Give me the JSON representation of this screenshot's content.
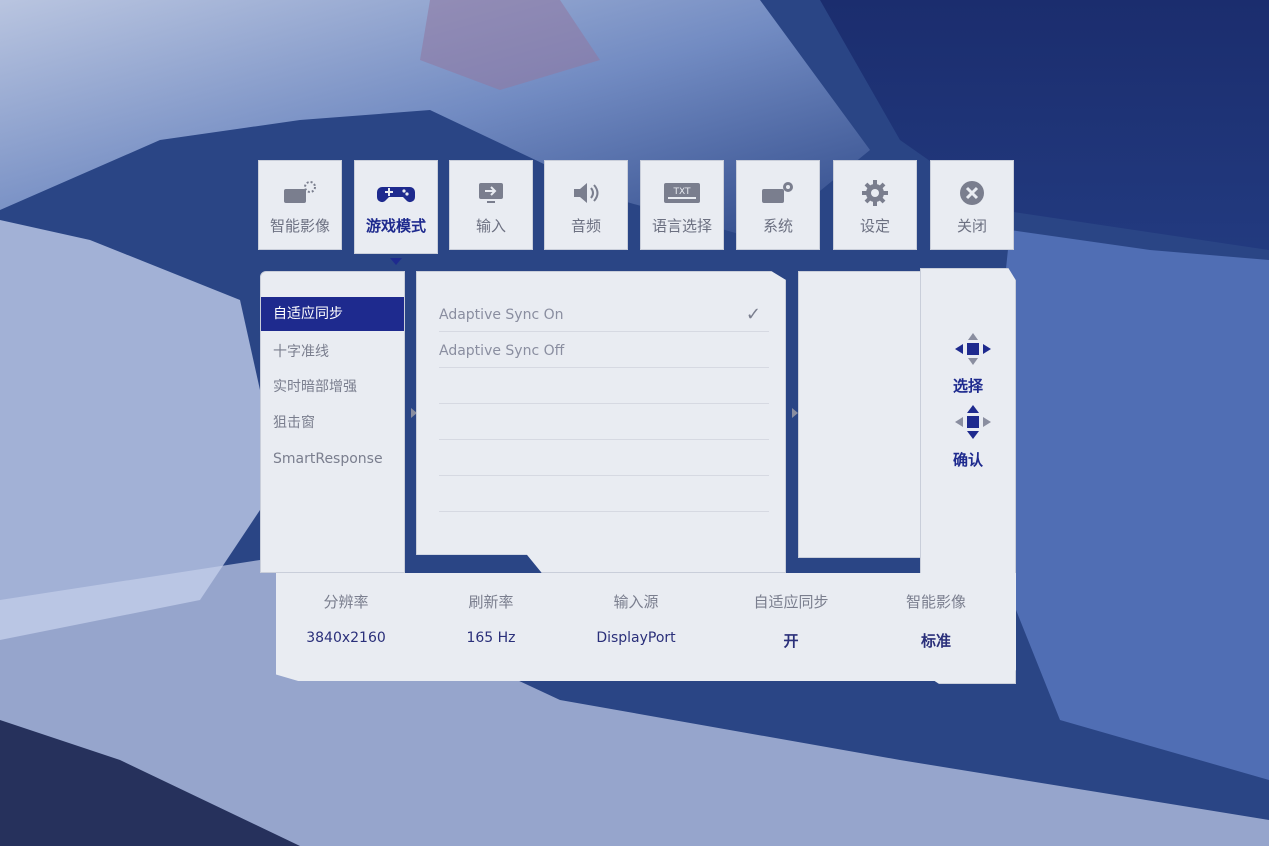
{
  "tabs": [
    {
      "label": "智能影像",
      "icon": "smart-image-icon",
      "active": false
    },
    {
      "label": "游戏模式",
      "icon": "gamepad-icon",
      "active": true
    },
    {
      "label": "输入",
      "icon": "input-icon",
      "active": false
    },
    {
      "label": "音频",
      "icon": "speaker-icon",
      "active": false
    },
    {
      "label": "语言选择",
      "icon": "language-txt-icon",
      "active": false
    },
    {
      "label": "系统",
      "icon": "system-icon",
      "active": false
    },
    {
      "label": "设定",
      "icon": "gear-icon",
      "active": false
    },
    {
      "label": "关闭",
      "icon": "close-icon",
      "active": false
    }
  ],
  "submenu": {
    "items": [
      "自适应同步",
      "十字准线",
      "实时暗部增强",
      "狙击窗",
      "SmartResponse"
    ],
    "selected": "自适应同步"
  },
  "options": {
    "items": [
      {
        "label": "Adaptive Sync On",
        "checked": true
      },
      {
        "label": "Adaptive Sync Off",
        "checked": false
      }
    ],
    "check_mark": "✓"
  },
  "controls": {
    "select_label": "选择",
    "confirm_label": "确认"
  },
  "info": {
    "headers": [
      "分辨率",
      "刷新率",
      "输入源",
      "自适应同步",
      "智能影像"
    ],
    "values": [
      "3840x2160",
      "165 Hz",
      "DisplayPort",
      "开",
      "标准"
    ]
  },
  "colors": {
    "accent": "#1e2a8e",
    "panel": "#e9ecf2",
    "text_muted": "#7a7e8e"
  }
}
